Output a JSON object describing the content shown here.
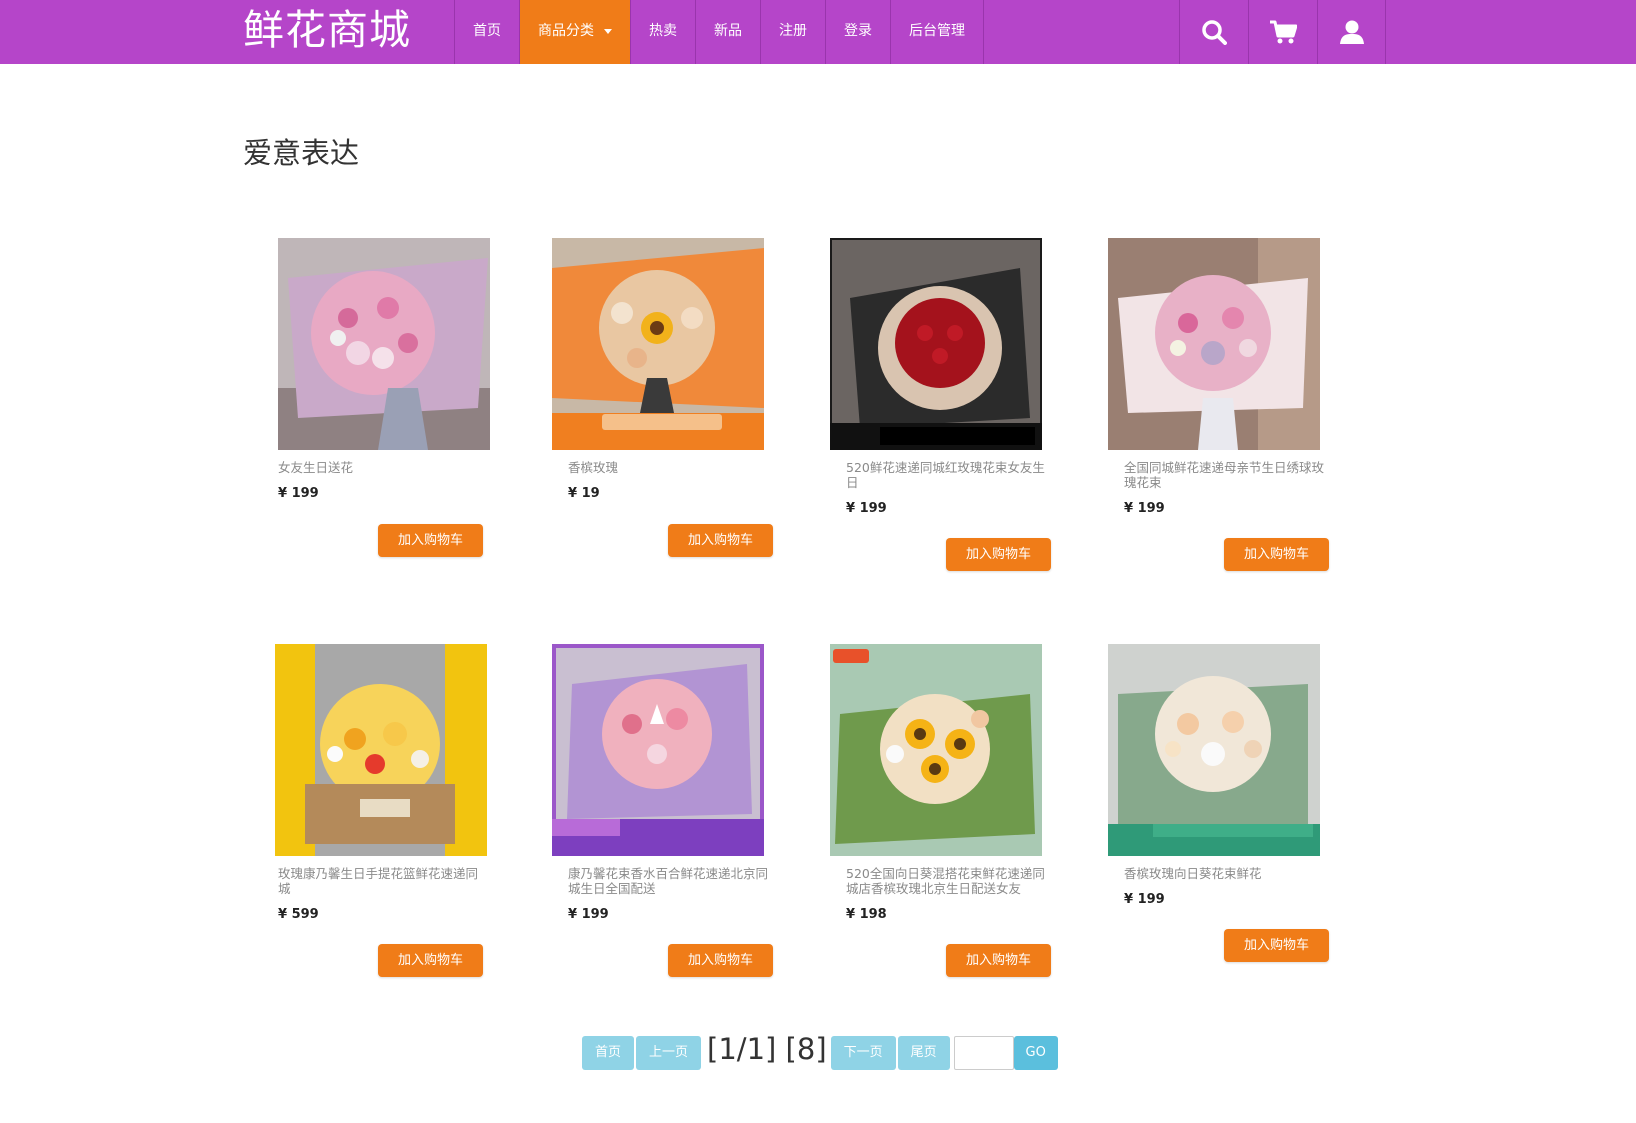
{
  "header": {
    "brand": "鲜花商城",
    "nav": [
      {
        "label": "首页"
      },
      {
        "label": "商品分类"
      },
      {
        "label": "热卖"
      },
      {
        "label": "新品"
      },
      {
        "label": "注册"
      },
      {
        "label": "登录"
      },
      {
        "label": "后台管理"
      }
    ],
    "active_color": "#f07c18",
    "bar_color": "#b545c9"
  },
  "section": {
    "title": "爱意表达"
  },
  "products": [
    {
      "name": "女友生日送花",
      "price": "¥ 199",
      "button": "加入购物车"
    },
    {
      "name": "香槟玫瑰",
      "price": "¥ 19",
      "button": "加入购物车"
    },
    {
      "name": "520鲜花速递同城红玫瑰花束女友生日",
      "price": "¥ 199",
      "button": "加入购物车"
    },
    {
      "name": "全国同城鲜花速递母亲节生日绣球玫瑰花束",
      "price": "¥ 199",
      "button": "加入购物车"
    },
    {
      "name": "玫瑰康乃馨生日手提花篮鲜花速递同城",
      "price": "¥ 599",
      "button": "加入购物车"
    },
    {
      "name": "康乃馨花束香水百合鲜花速递北京同城生日全国配送",
      "price": "¥ 199",
      "button": "加入购物车"
    },
    {
      "name": "520全国向日葵混搭花束鲜花速递同城店香槟玫瑰北京生日配送女友",
      "price": "¥ 198",
      "button": "加入购物车"
    },
    {
      "name": "香槟玫瑰向日葵花束鲜花",
      "price": "¥ 199",
      "button": "加入购物车"
    }
  ],
  "pagination": {
    "first": "首页",
    "prev": "上一页",
    "info": "[1/1] [8]",
    "next": "下一页",
    "last": "尾页",
    "input_value": "",
    "go": "GO"
  },
  "icons": [
    "search-icon",
    "cart-icon",
    "user-icon"
  ]
}
